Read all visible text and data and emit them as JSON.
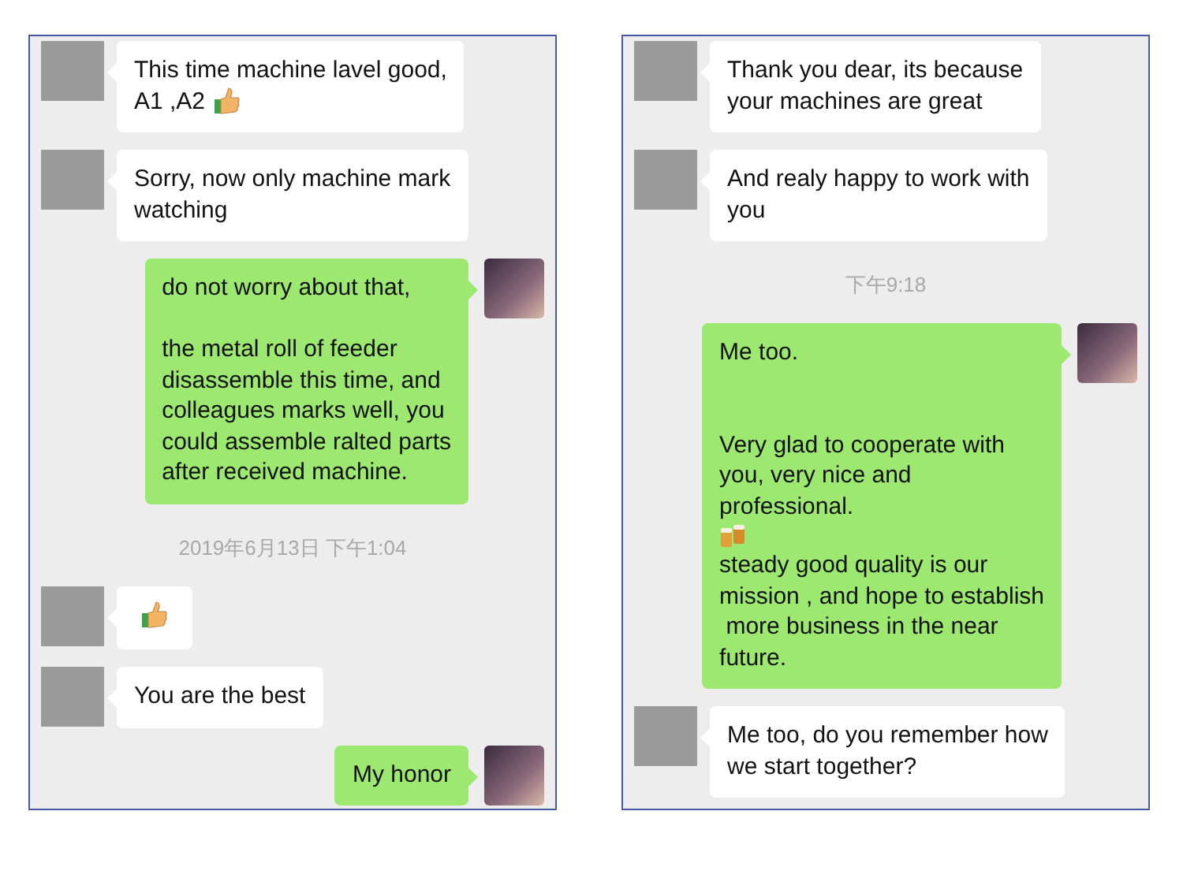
{
  "panels": [
    {
      "messages": [
        {
          "kind": "received",
          "blocks": [
            {
              "kind": "text",
              "text": "This time machine lavel good,"
            },
            {
              "kind": "text_thumb",
              "text": "A1 ,A2"
            }
          ]
        },
        {
          "kind": "received",
          "blocks": [
            {
              "kind": "text",
              "text": "Sorry, now only machine mark\nwatching"
            }
          ]
        },
        {
          "kind": "sent",
          "blocks": [
            {
              "kind": "text",
              "text": "do not worry about that,\n\nthe metal roll of feeder\ndisassemble this time, and\ncolleagues marks well, you\ncould assemble ralted parts\nafter received machine."
            }
          ]
        },
        {
          "kind": "time",
          "text": "2019年6月13日 下午1:04"
        },
        {
          "kind": "received",
          "blocks": [
            {
              "kind": "thumb"
            }
          ]
        },
        {
          "kind": "received",
          "blocks": [
            {
              "kind": "text",
              "text": "You are the best"
            }
          ]
        },
        {
          "kind": "sent",
          "blocks": [
            {
              "kind": "text",
              "text": "My honor"
            }
          ]
        }
      ]
    },
    {
      "messages": [
        {
          "kind": "received",
          "blocks": [
            {
              "kind": "text",
              "text": "Thank you dear, its because\nyour machines are great"
            }
          ]
        },
        {
          "kind": "received",
          "blocks": [
            {
              "kind": "text",
              "text": "And realy happy to work with\nyou"
            }
          ]
        },
        {
          "kind": "time",
          "text": "下午9:18"
        },
        {
          "kind": "sent",
          "blocks": [
            {
              "kind": "text",
              "text": "Me too.\n\n\nVery glad to cooperate with\nyou, very nice and\nprofessional."
            },
            {
              "kind": "beer"
            },
            {
              "kind": "text",
              "text": "steady good quality is our\nmission , and hope to establish\n more business in the near\nfuture."
            }
          ]
        },
        {
          "kind": "received",
          "blocks": [
            {
              "kind": "text",
              "text": "Me too, do you remember how\nwe start together?"
            }
          ]
        }
      ]
    }
  ]
}
